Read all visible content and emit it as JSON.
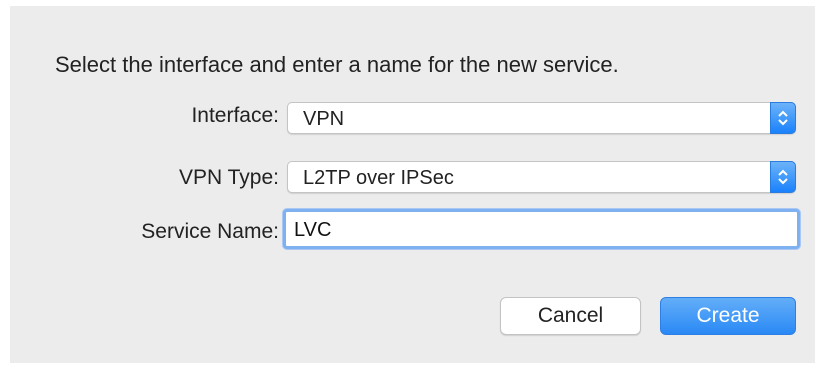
{
  "dialog": {
    "instruction": "Select the interface and enter a name for the new service.",
    "interface": {
      "label": "Interface:",
      "value": "VPN"
    },
    "vpn_type": {
      "label": "VPN Type:",
      "value": "L2TP over IPSec"
    },
    "service_name": {
      "label": "Service Name:",
      "value": "LVC"
    },
    "buttons": {
      "cancel": "Cancel",
      "create": "Create"
    }
  },
  "colors": {
    "accent": "#2a89f5",
    "dialog_background": "#ececec",
    "focus_ring": "#7fb0f0"
  },
  "icons": {
    "popup_arrows": "up-down-chevron-icon"
  }
}
